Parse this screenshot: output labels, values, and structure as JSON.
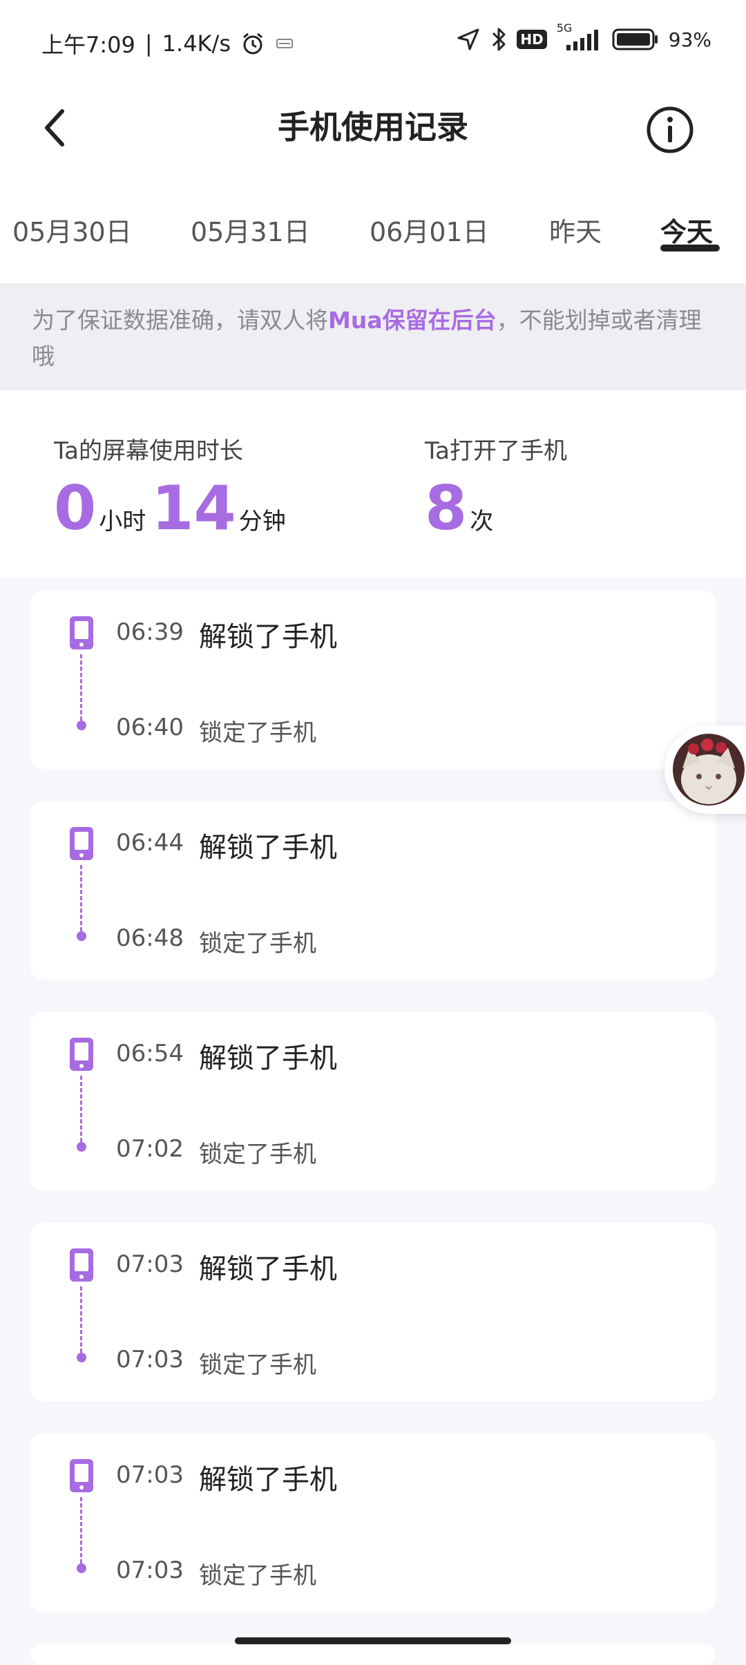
{
  "status_bar": {
    "time": "上午7:09",
    "network_speed": "1.4K/s",
    "network_type": "5G",
    "hd_badge": "HD",
    "battery": "93%",
    "icons": [
      "alarm-icon",
      "notification-icon",
      "location-icon",
      "bluetooth-icon",
      "signal-icon",
      "battery-icon"
    ]
  },
  "header": {
    "title": "手机使用记录",
    "back_icon": "chevron-left-icon",
    "info_icon": "info-icon"
  },
  "date_tabs": [
    {
      "label": "05月30日",
      "active": false
    },
    {
      "label": "05月31日",
      "active": false
    },
    {
      "label": "06月01日",
      "active": false
    },
    {
      "label": "昨天",
      "active": false
    },
    {
      "label": "今天",
      "active": true
    }
  ],
  "notice": {
    "prefix": "为了保证数据准确，请双人将",
    "highlight": "Mua保留在后台",
    "suffix": "，不能划掉或者清理哦"
  },
  "stats": {
    "screen_time_label": "Ta的屏幕使用时长",
    "hours": "0",
    "hours_unit": "小时",
    "minutes": "14",
    "minutes_unit": "分钟",
    "unlock_count_label": "Ta打开了手机",
    "unlock_count": "8",
    "unlock_count_unit": "次"
  },
  "records": [
    {
      "unlock_time": "06:39",
      "unlock_text": "解锁了手机",
      "lock_time": "06:40",
      "lock_text": "锁定了手机"
    },
    {
      "unlock_time": "06:44",
      "unlock_text": "解锁了手机",
      "lock_time": "06:48",
      "lock_text": "锁定了手机"
    },
    {
      "unlock_time": "06:54",
      "unlock_text": "解锁了手机",
      "lock_time": "07:02",
      "lock_text": "锁定了手机"
    },
    {
      "unlock_time": "07:03",
      "unlock_text": "解锁了手机",
      "lock_time": "07:03",
      "lock_text": "锁定了手机"
    },
    {
      "unlock_time": "07:03",
      "unlock_text": "解锁了手机",
      "lock_time": "07:03",
      "lock_text": "锁定了手机"
    }
  ],
  "colors": {
    "accent": "#a76be2",
    "text_dark": "#222222",
    "text_muted": "#8a8a90",
    "banner_bg": "#efeef2",
    "page_bg": "#f8f6fb"
  }
}
